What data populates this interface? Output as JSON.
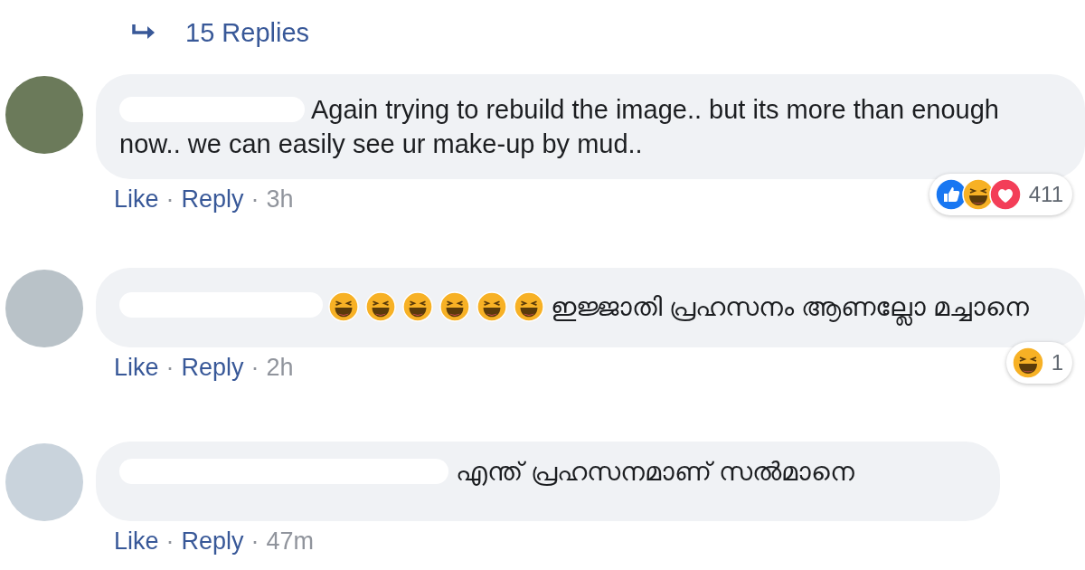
{
  "replies_link": {
    "label": "15 Replies"
  },
  "comments": [
    {
      "text": "Again trying to rebuild the image.. but its more than enough now.. we can easily see ur make-up by mud..",
      "meta": [
        {
          "kind": "link",
          "text": "Like"
        },
        {
          "kind": "dot",
          "text": "·"
        },
        {
          "kind": "link",
          "text": "Reply"
        },
        {
          "kind": "dot",
          "text": "·"
        },
        {
          "kind": "time",
          "text": "3h"
        }
      ],
      "reactions": {
        "icons": [
          {
            "kind": "like"
          },
          {
            "kind": "haha"
          },
          {
            "kind": "love"
          }
        ],
        "count": "411"
      }
    },
    {
      "leading_emoji": [
        {
          "kind": "haha"
        },
        {
          "kind": "haha"
        },
        {
          "kind": "haha"
        },
        {
          "kind": "haha"
        },
        {
          "kind": "haha"
        },
        {
          "kind": "haha"
        }
      ],
      "text": "ഇജ്ജാതി പ്രഹസനം ആണല്ലോ മച്ചാനെ",
      "meta": [
        {
          "kind": "link",
          "text": "Like"
        },
        {
          "kind": "dot",
          "text": "·"
        },
        {
          "kind": "link",
          "text": "Reply"
        },
        {
          "kind": "dot",
          "text": "·"
        },
        {
          "kind": "time",
          "text": "2h"
        }
      ],
      "reactions": {
        "icons": [
          {
            "kind": "haha"
          }
        ],
        "count": "1"
      }
    },
    {
      "text": "എന്ത് പ്രഹസനമാണ് സൽമാനെ",
      "meta": [
        {
          "kind": "link",
          "text": "Like"
        },
        {
          "kind": "dot",
          "text": "·"
        },
        {
          "kind": "link",
          "text": "Reply"
        },
        {
          "kind": "dot",
          "text": "·"
        },
        {
          "kind": "time",
          "text": "47m"
        }
      ]
    }
  ]
}
